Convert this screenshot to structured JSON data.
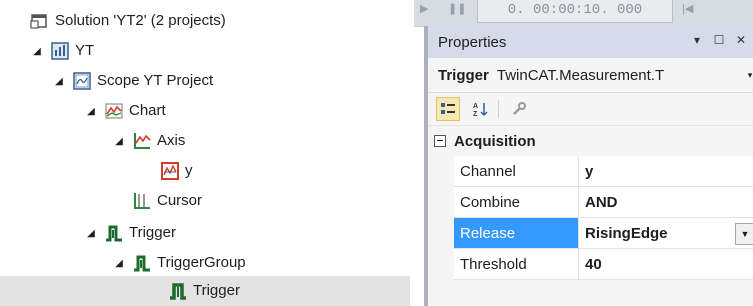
{
  "tree": {
    "items": [
      {
        "label": "Solution 'YT2' (2 projects)",
        "icon": "solution-icon",
        "expander": ""
      },
      {
        "label": "YT",
        "icon": "yt-project-icon",
        "expander": "◢"
      },
      {
        "label": "Scope YT Project",
        "icon": "scope-project-icon",
        "expander": "◢"
      },
      {
        "label": "Chart",
        "icon": "chart-icon",
        "expander": "◢"
      },
      {
        "label": "Axis",
        "icon": "axis-icon",
        "expander": "◢"
      },
      {
        "label": "y",
        "icon": "channel-icon",
        "expander": ""
      },
      {
        "label": "Cursor",
        "icon": "cursor-icon",
        "expander": ""
      },
      {
        "label": "Trigger",
        "icon": "trigger-icon",
        "expander": "◢"
      },
      {
        "label": "TriggerGroup",
        "icon": "trigger-group-icon",
        "expander": "◢"
      },
      {
        "label": "Trigger",
        "icon": "trigger-item-icon",
        "expander": "",
        "selected": true
      }
    ]
  },
  "timestrip": {
    "time": "0. 00:00:10. 000"
  },
  "properties": {
    "title": "Properties",
    "title_buttons": [
      "▾",
      "☐",
      "✕"
    ],
    "object_name": "Trigger",
    "object_type": "TwinCAT.Measurement.T",
    "toolbar": [
      "categorized-icon",
      "alphabetical-icon",
      "property-pages-icon"
    ],
    "category": "Acquisition",
    "rows": [
      {
        "name": "Channel",
        "value": "y"
      },
      {
        "name": "Combine",
        "value": "AND"
      },
      {
        "name": "Release",
        "value": "RisingEdge",
        "selected": true,
        "dropdown": true
      },
      {
        "name": "Threshold",
        "value": "40"
      }
    ]
  },
  "colors": {
    "selection": "#3399ff",
    "tree_selection": "#e3e3e3",
    "panel_header": "#d6dbe9"
  }
}
